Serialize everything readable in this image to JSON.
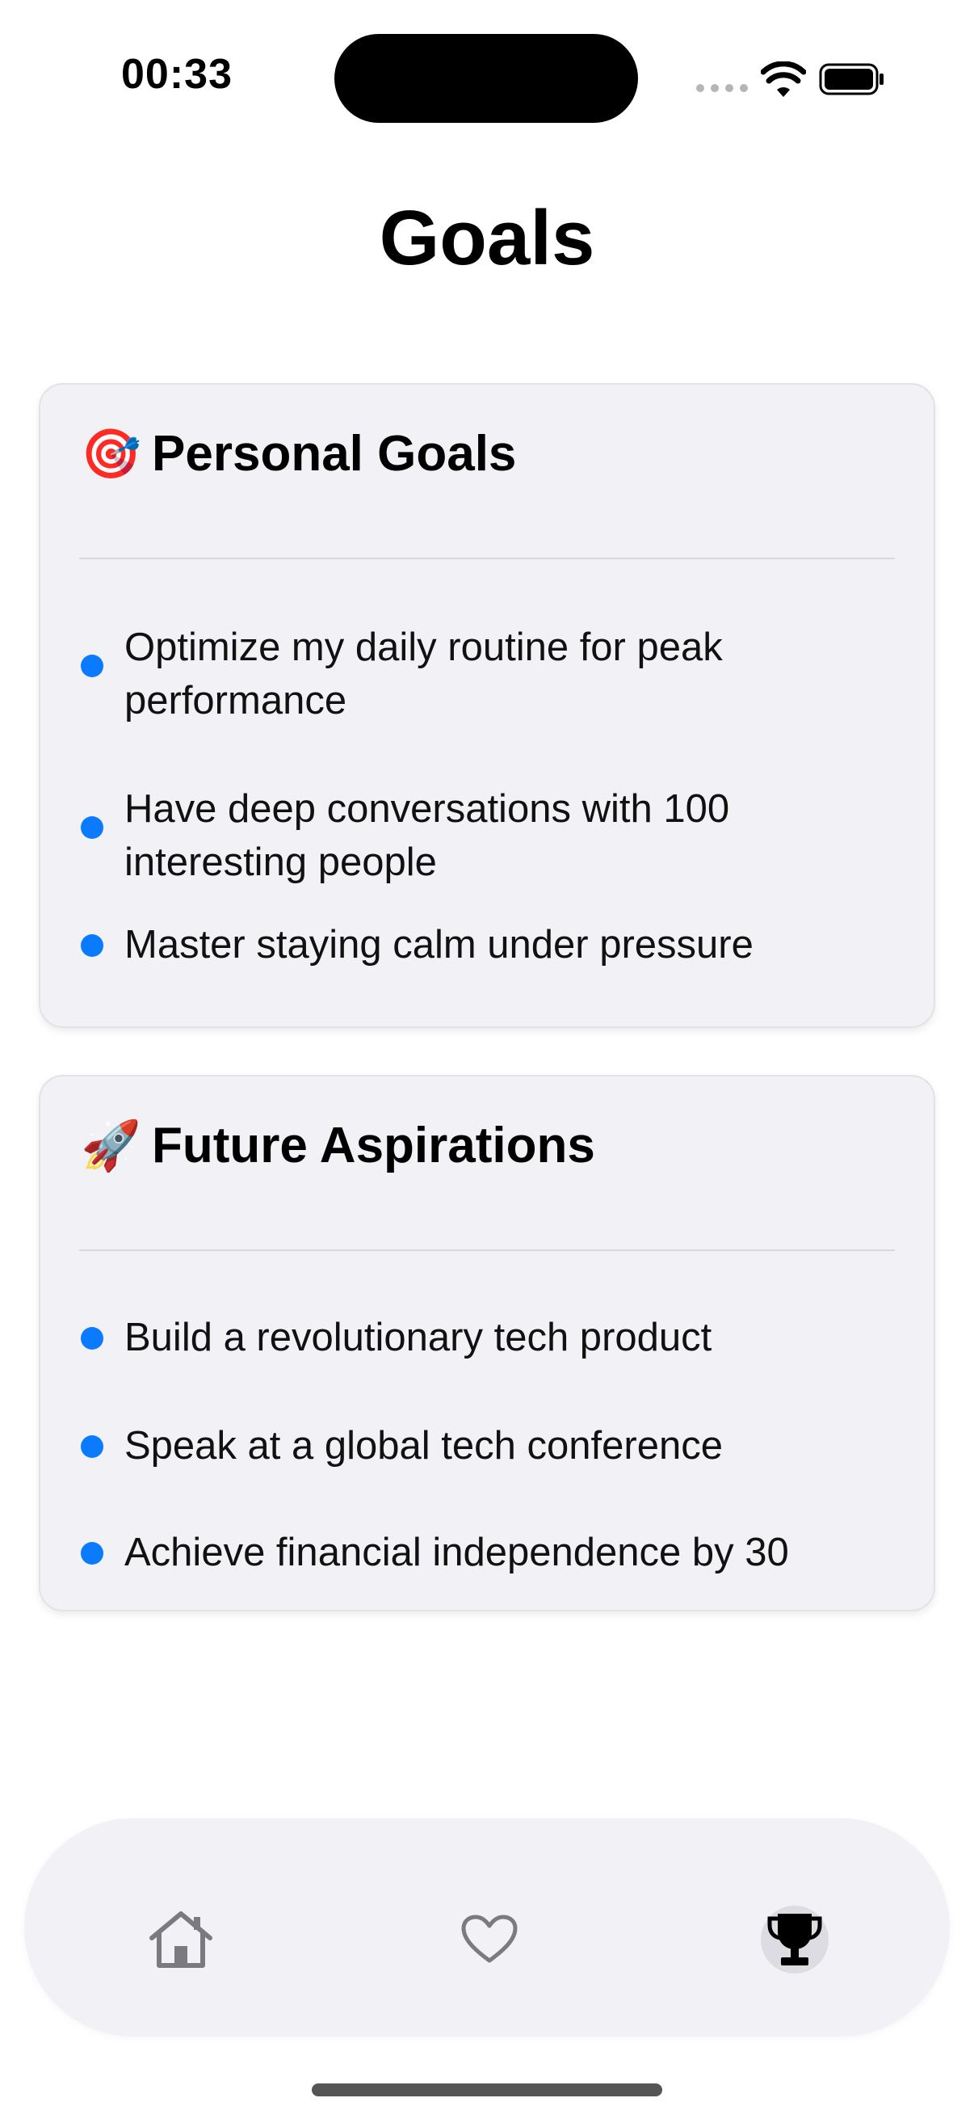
{
  "status_bar": {
    "time": "00:33",
    "icons": [
      "cellular-signal-icon",
      "wifi-icon",
      "battery-icon"
    ]
  },
  "page": {
    "title": "Goals"
  },
  "sections": [
    {
      "emoji": "🎯",
      "title": "Personal Goals",
      "items": [
        "Optimize my daily routine for peak performance",
        "Have deep conversations with 100 interesting people",
        "Master staying calm under pressure"
      ]
    },
    {
      "emoji": "🚀",
      "title": "Future Aspirations",
      "items": [
        "Build a revolutionary tech product",
        "Speak at a global tech conference",
        "Achieve financial independence by 30"
      ]
    }
  ],
  "tab_bar": {
    "tabs": [
      {
        "icon": "home-icon",
        "active": false
      },
      {
        "icon": "heart-icon",
        "active": false
      },
      {
        "icon": "trophy-icon",
        "active": true
      }
    ]
  },
  "colors": {
    "accent": "#0a7aff",
    "card_background": "#f1f1f6",
    "tab_inactive": "#7a7a80",
    "tab_active": "#000000"
  }
}
